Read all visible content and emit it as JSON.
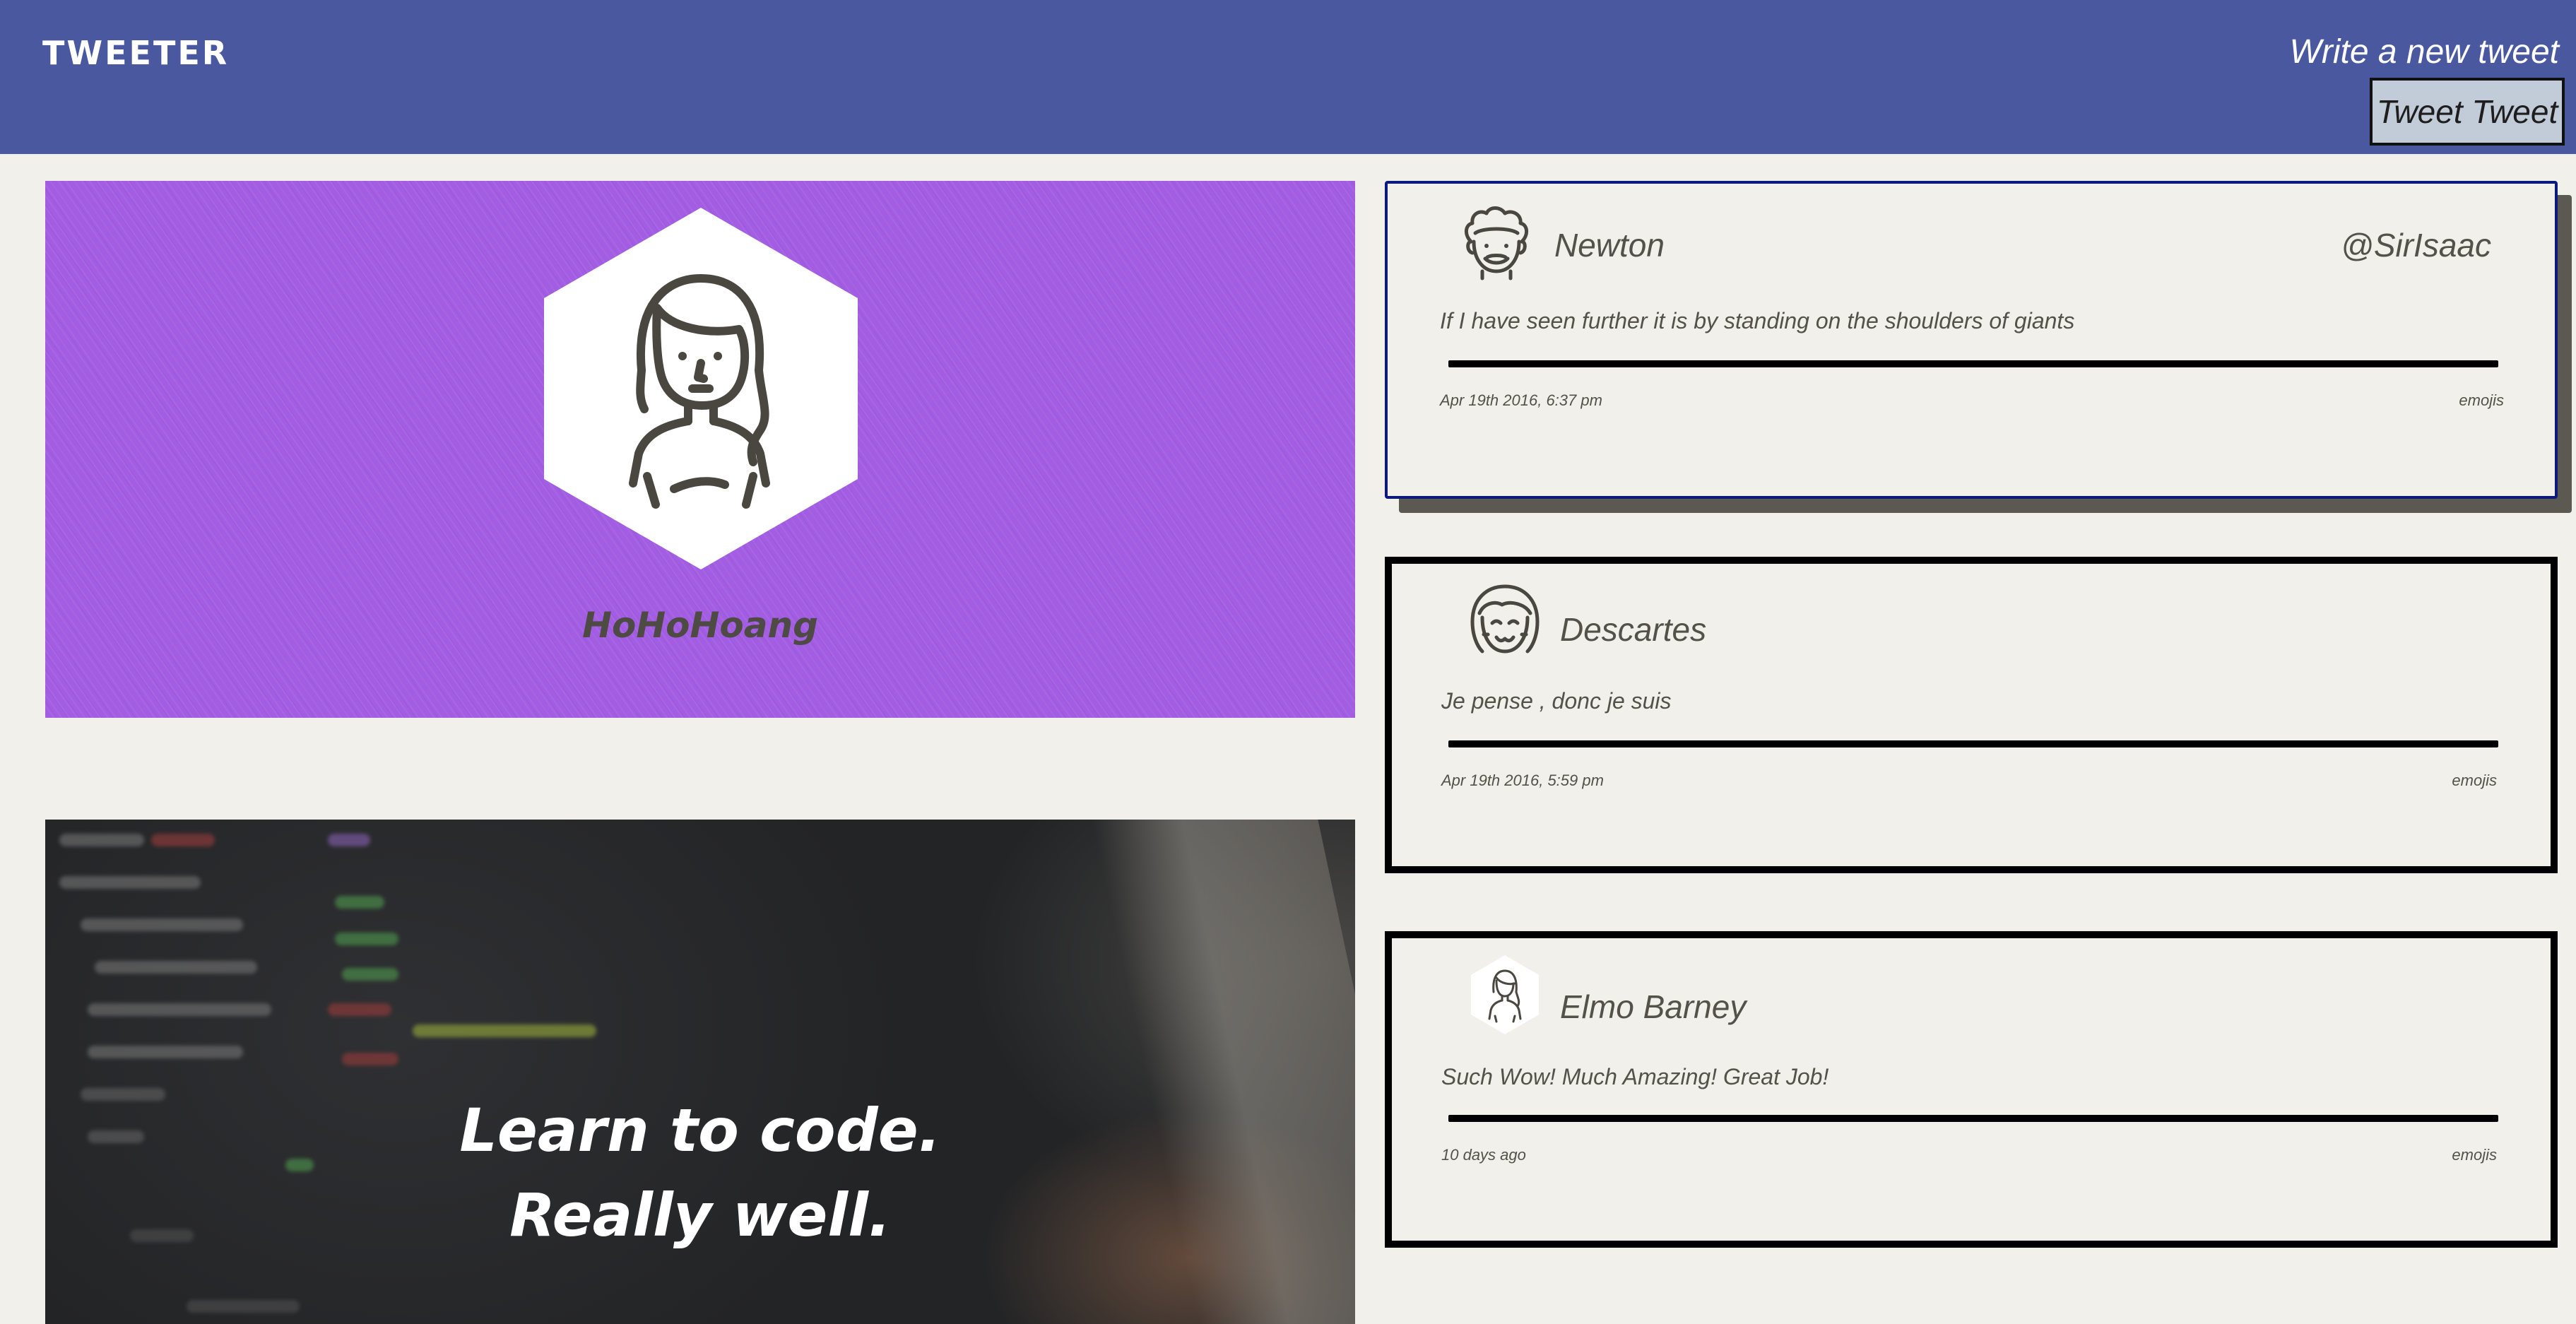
{
  "nav": {
    "brand": "TWEETER",
    "compose_link": "Write a new tweet",
    "compose_button": "Tweet Tweet",
    "color": "#4a58a0"
  },
  "profile": {
    "name": "HoHoHoang",
    "background_color": "#a25de2",
    "avatar_icon": "girl-avatar-icon"
  },
  "promo": {
    "line1": "Learn to code.",
    "line2": "Really well."
  },
  "tweets": [
    {
      "name": "Newton",
      "handle": "@SirIsaac",
      "content": "If I have seen further it is by standing on the shoulders of giants",
      "date": "Apr 19th 2016, 6:37 pm",
      "emojis": "emojis",
      "avatar_icon": "curly-hair-avatar-icon"
    },
    {
      "name": "Descartes",
      "content": "Je pense , donc je suis",
      "date": "Apr 19th 2016, 5:59 pm",
      "emojis": "emojis",
      "avatar_icon": "bob-hair-avatar-icon"
    },
    {
      "name": "Elmo Barney",
      "content": "Such Wow! Much Amazing! Great Job!",
      "date": "10 days ago",
      "emojis": "emojis",
      "avatar_icon": "girl-hexagon-avatar-icon"
    }
  ]
}
